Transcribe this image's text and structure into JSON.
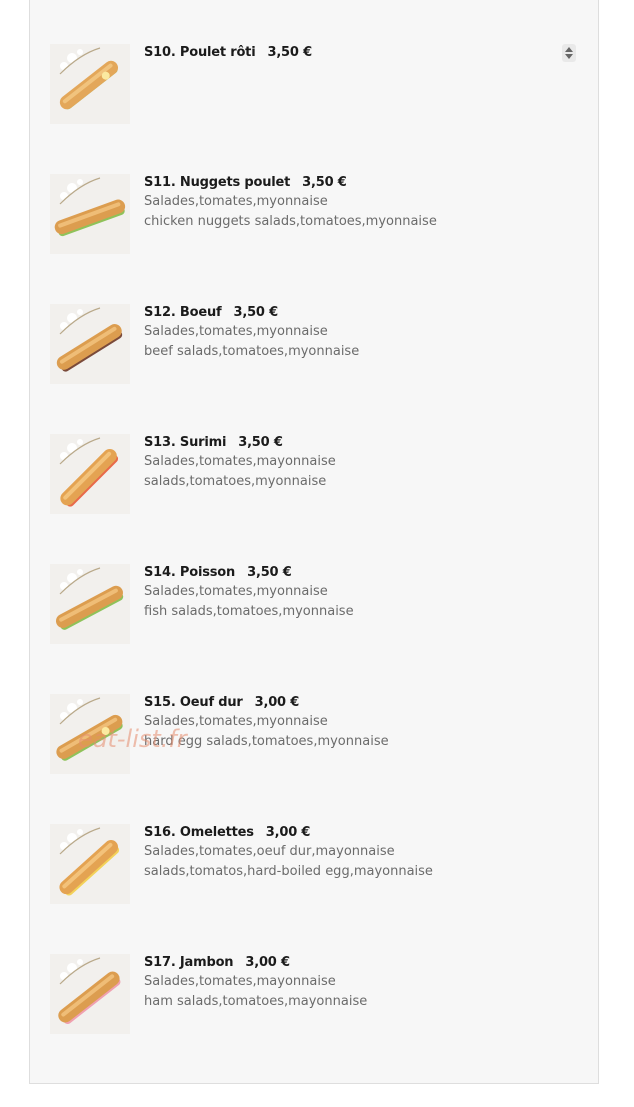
{
  "watermark": "eat-list.fr",
  "items": [
    {
      "code": "S10. Poulet rôti",
      "price": "3,50 €",
      "desc1": "",
      "desc2": ""
    },
    {
      "code": "S11. Nuggets poulet",
      "price": "3,50 €",
      "desc1": "Salades,tomates,myonnaise",
      "desc2": "chicken nuggets salads,tomatoes,myonnaise"
    },
    {
      "code": "S12. Boeuf",
      "price": "3,50 €",
      "desc1": "Salades,tomates,myonnaise",
      "desc2": "beef salads,tomatoes,myonnaise"
    },
    {
      "code": "S13. Surimi",
      "price": "3,50 €",
      "desc1": "Salades,tomates,mayonnaise",
      "desc2": "salads,tomatoes,myonnaise"
    },
    {
      "code": "S14. Poisson",
      "price": "3,50 €",
      "desc1": "Salades,tomates,myonnaise",
      "desc2": "fish salads,tomatoes,myonnaise"
    },
    {
      "code": "S15. Oeuf dur",
      "price": "3,00 €",
      "desc1": "Salades,tomates,myonnaise",
      "desc2": "hard egg salads,tomatoes,myonnaise"
    },
    {
      "code": "S16. Omelettes",
      "price": "3,00 €",
      "desc1": "Salades,tomates,oeuf dur,mayonnaise",
      "desc2": "salads,tomatos,hard-boiled egg,mayonnaise"
    },
    {
      "code": "S17. Jambon",
      "price": "3,00 €",
      "desc1": "Salades,tomates,mayonnaise",
      "desc2": "ham salads,tomatoes,mayonnaise"
    }
  ]
}
